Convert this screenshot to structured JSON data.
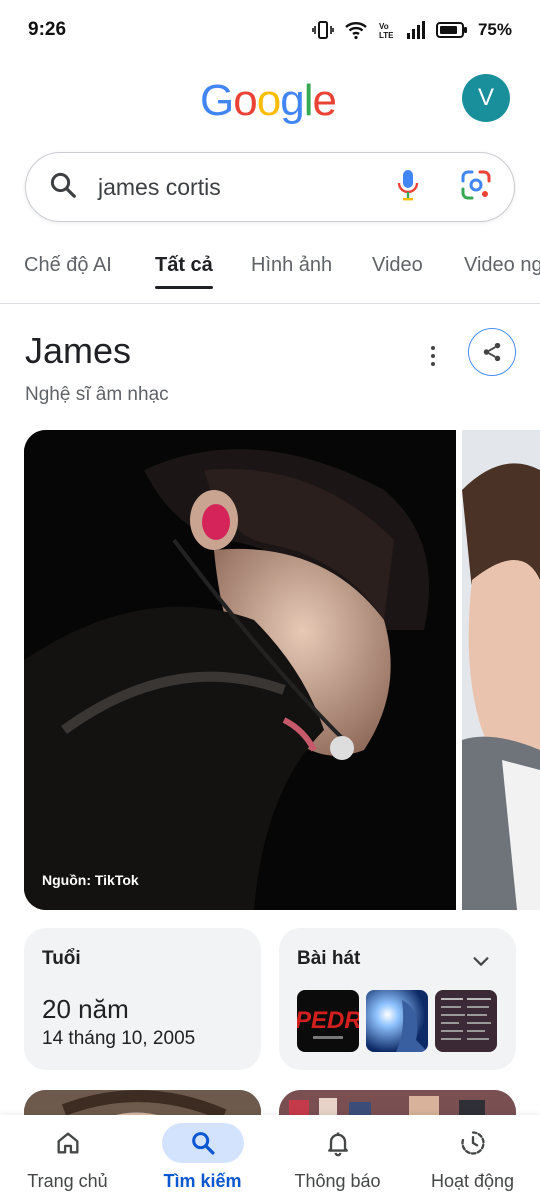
{
  "status_bar": {
    "time": "9:26",
    "battery": "75%"
  },
  "header": {
    "logo": [
      "G",
      "o",
      "o",
      "g",
      "l",
      "e"
    ],
    "logo_colors": [
      "#4285F4",
      "#EA4335",
      "#FBBC05",
      "#4285F4",
      "#34A853",
      "#EA4335"
    ],
    "avatar_initial": "V",
    "avatar_color": "#1a8f9c"
  },
  "search": {
    "query": "james cortis"
  },
  "tabs": [
    "Chế độ AI",
    "Tất cả",
    "Hình ảnh",
    "Video",
    "Video ng"
  ],
  "active_tab_index": 1,
  "entity": {
    "title": "James",
    "subtitle": "Nghệ sĩ âm nhạc",
    "image_source": "Nguồn: TikTok"
  },
  "cards": {
    "age": {
      "label": "Tuổi",
      "value": "20 năm",
      "date": "14 tháng 10, 2005"
    },
    "songs": {
      "label": "Bài hát"
    }
  },
  "bottom_nav": [
    {
      "label": "Trang chủ",
      "icon": "home-icon"
    },
    {
      "label": "Tìm kiếm",
      "icon": "search-icon"
    },
    {
      "label": "Thông báo",
      "icon": "bell-icon"
    },
    {
      "label": "Hoạt động",
      "icon": "activity-icon"
    }
  ],
  "active_nav_index": 1,
  "colors": {
    "accent": "#0b57d0",
    "nav_active_bg": "#d3e3fd"
  }
}
